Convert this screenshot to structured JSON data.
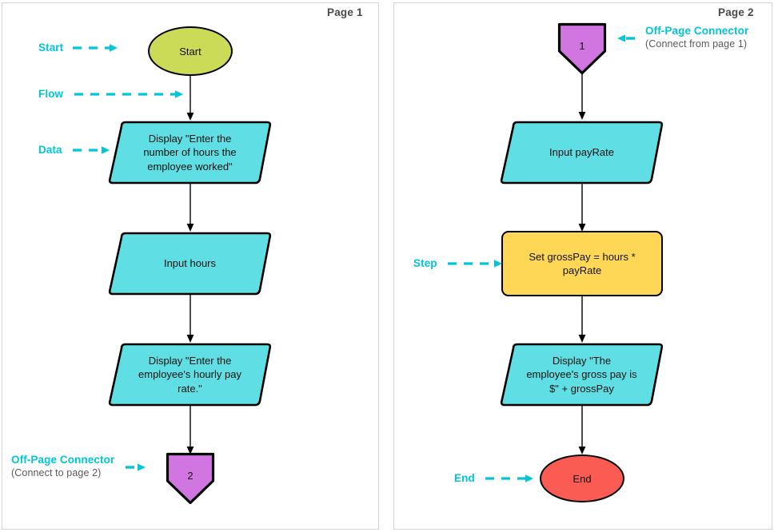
{
  "document": {
    "type": "flowchart",
    "title": "Two-page payroll gross pay flowchart",
    "pages": [
      {
        "id": "page1",
        "label": "Page 1"
      },
      {
        "id": "page2",
        "label": "Page 2"
      }
    ]
  },
  "colors": {
    "terminator_start": "#ccdb57",
    "terminator_end": "#fa5b52",
    "data": "#5fdfe3",
    "process": "#ffd756",
    "offpage_connector": "#d175e0",
    "annotation": "#00c6d7",
    "annotation_sub": "#5b5b5b",
    "outline": "#000000",
    "page_border": "#d6d6d6",
    "page_label": "#4a4a4a"
  },
  "page1": {
    "label": "Page 1",
    "nodes": {
      "start": {
        "text": "Start",
        "shape": "ellipse"
      },
      "display_hours_prompt": {
        "text": "Display \"Enter the\nnumber of hours the\nemployee worked\"",
        "shape": "parallelogram"
      },
      "input_hours": {
        "text": "Input hours",
        "shape": "parallelogram"
      },
      "display_rate_prompt": {
        "text": "Display \"Enter the\nemployee's hourly pay\nrate.\"",
        "shape": "parallelogram"
      },
      "offpage_out": {
        "text": "2",
        "shape": "pentagon-down"
      }
    },
    "annotations": [
      {
        "name": "start",
        "label": "Start",
        "sub": ""
      },
      {
        "name": "flow",
        "label": "Flow",
        "sub": ""
      },
      {
        "name": "data",
        "label": "Data",
        "sub": ""
      },
      {
        "name": "offpage",
        "label": "Off-Page Connector",
        "sub": "(Connect to page 2)"
      }
    ]
  },
  "page2": {
    "label": "Page 2",
    "nodes": {
      "offpage_in": {
        "text": "1",
        "shape": "pentagon-down"
      },
      "input_payrate": {
        "text": "Input payRate",
        "shape": "parallelogram"
      },
      "set_grosspay": {
        "text": "Set grossPay = hours *\npayRate",
        "shape": "rectangle"
      },
      "display_grosspay": {
        "text": "Display \"The\nemployee's gross pay is\n$\" + grossPay",
        "shape": "parallelogram"
      },
      "end": {
        "text": "End",
        "shape": "ellipse"
      }
    },
    "annotations": [
      {
        "name": "offpage",
        "label": "Off-Page Connector",
        "sub": "(Connect from page 1)"
      },
      {
        "name": "step",
        "label": "Step",
        "sub": ""
      },
      {
        "name": "end",
        "label": "End",
        "sub": ""
      }
    ]
  }
}
